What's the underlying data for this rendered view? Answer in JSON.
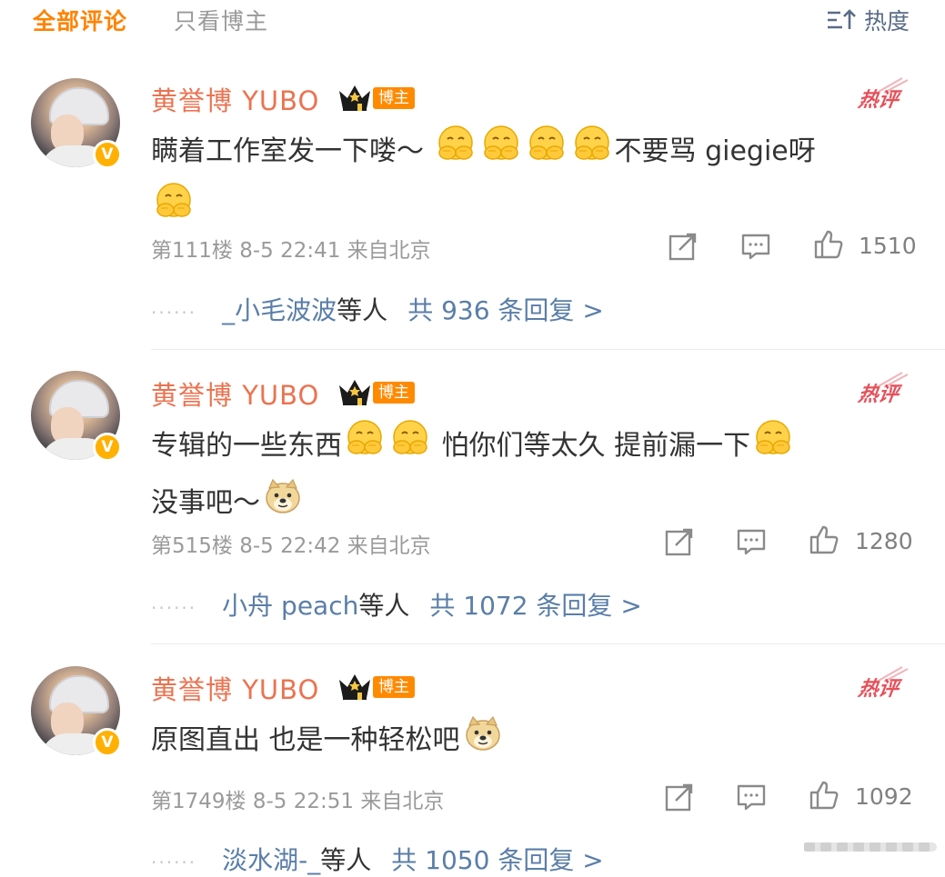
{
  "tabs": {
    "all": "全部评论",
    "owner_only": "只看博主",
    "sort_label": "热度"
  },
  "comments": [
    {
      "author": "黄誉博 YUBO",
      "owner_tag": "博主",
      "hot_label": "热评",
      "text_a": "瞒着工作室发一下喽～",
      "text_b": "不要骂 giegie呀",
      "floor_time_loc": "第111楼 8-5 22:41 来自北京",
      "likes": "1510",
      "reply_users": "_小毛波波",
      "reply_etc": "等人",
      "reply_count": "共 936 条回复 >"
    },
    {
      "author": "黄誉博 YUBO",
      "owner_tag": "博主",
      "hot_label": "热评",
      "text_a": "专辑的一些东西",
      "text_b": "怕你们等太久 提前漏一下",
      "text_c": "没事吧～",
      "floor_time_loc": "第515楼 8-5 22:42 来自北京",
      "likes": "1280",
      "reply_users": "小舟 peach",
      "reply_etc": "等人",
      "reply_count": "共 1072 条回复 >"
    },
    {
      "author": "黄誉博 YUBO",
      "owner_tag": "博主",
      "hot_label": "热评",
      "text_a": "原图直出 也是一种轻松吧",
      "floor_time_loc": "第1749楼 8-5 22:51 来自北京",
      "likes": "1092",
      "reply_users": "淡水湖-_",
      "reply_etc": "等人",
      "reply_count": "共 1050 条回复 >"
    }
  ],
  "icons": {
    "sort": "sort-bars-icon",
    "share": "share-icon",
    "comment": "comment-icon",
    "like": "thumbs-up-icon",
    "verified": "verified-v-icon",
    "crown": "crown-icon",
    "emoji_cover": "face-covering-mouth-emoji",
    "emoji_doge": "doge-emoji"
  },
  "colors": {
    "accent": "#ff8200",
    "name": "#eb7350",
    "link": "#5a7ea8",
    "hot": "#e6505a",
    "meta": "#9a9a9a"
  }
}
